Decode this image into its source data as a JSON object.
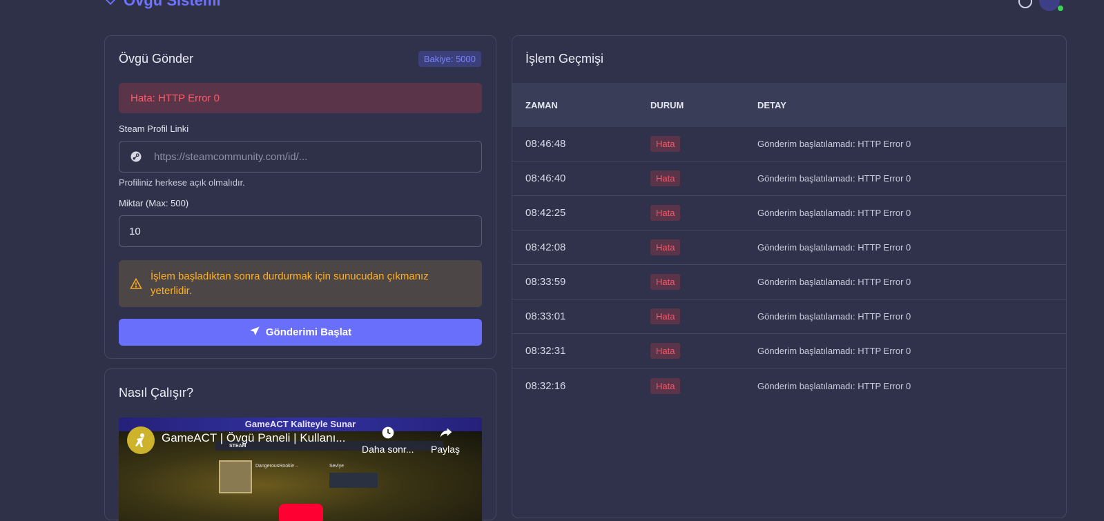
{
  "header": {
    "brand_title": "Övgü Sistemi"
  },
  "send_card": {
    "title": "Övgü Gönder",
    "balance_badge": "Bakiye: 5000",
    "error_message": "Hata: HTTP Error 0",
    "profile_label": "Steam Profil Linki",
    "profile_placeholder": "https://steamcommunity.com/id/...",
    "profile_hint": "Profiliniz herkese açık olmalıdır.",
    "amount_label": "Miktar (Max: 500)",
    "amount_value": "10",
    "warning_text": "İşlem başladıktan sonra durdurmak için sunucudan çıkmanız yeterlidir.",
    "start_button": "Gönderimi Başlat"
  },
  "how_card": {
    "title": "Nasıl Çalışır?",
    "video": {
      "banner": "GameACT Kaliteyle Sunar",
      "title": "GameACT | Övgü Paneli | Kullanı...",
      "watch_later": "Daha sonr...",
      "share": "Paylaş",
      "inner_steam_label": "STEAM",
      "inner_profile_name": "DangerousRookie ..",
      "inner_level_label": "Seviye"
    }
  },
  "history_card": {
    "title": "İşlem Geçmişi",
    "columns": [
      "ZAMAN",
      "DURUM",
      "DETAY"
    ],
    "rows": [
      {
        "time": "08:46:48",
        "status": "Hata",
        "detail": "Gönderim başlatılamadı: HTTP Error 0"
      },
      {
        "time": "08:46:40",
        "status": "Hata",
        "detail": "Gönderim başlatılamadı: HTTP Error 0"
      },
      {
        "time": "08:42:25",
        "status": "Hata",
        "detail": "Gönderim başlatılamadı: HTTP Error 0"
      },
      {
        "time": "08:42:08",
        "status": "Hata",
        "detail": "Gönderim başlatılamadı: HTTP Error 0"
      },
      {
        "time": "08:33:59",
        "status": "Hata",
        "detail": "Gönderim başlatılamadı: HTTP Error 0"
      },
      {
        "time": "08:33:01",
        "status": "Hata",
        "detail": "Gönderim başlatılamadı: HTTP Error 0"
      },
      {
        "time": "08:32:31",
        "status": "Hata",
        "detail": "Gönderim başlatılamadı: HTTP Error 0"
      },
      {
        "time": "08:32:16",
        "status": "Hata",
        "detail": "Gönderim başlatılamadı: HTTP Error 0"
      }
    ]
  },
  "colors": {
    "background": "#2f3149",
    "accent": "#6a6ffb",
    "error": "#ff5566",
    "warning": "#ffb020"
  },
  "icons": {
    "brand": "heart-icon",
    "profile_input": "steam-icon",
    "warning": "warning-triangle-icon",
    "start_button": "paper-plane-icon",
    "watch_later": "clock-icon",
    "share": "share-icon",
    "help": "help-circle-icon"
  }
}
